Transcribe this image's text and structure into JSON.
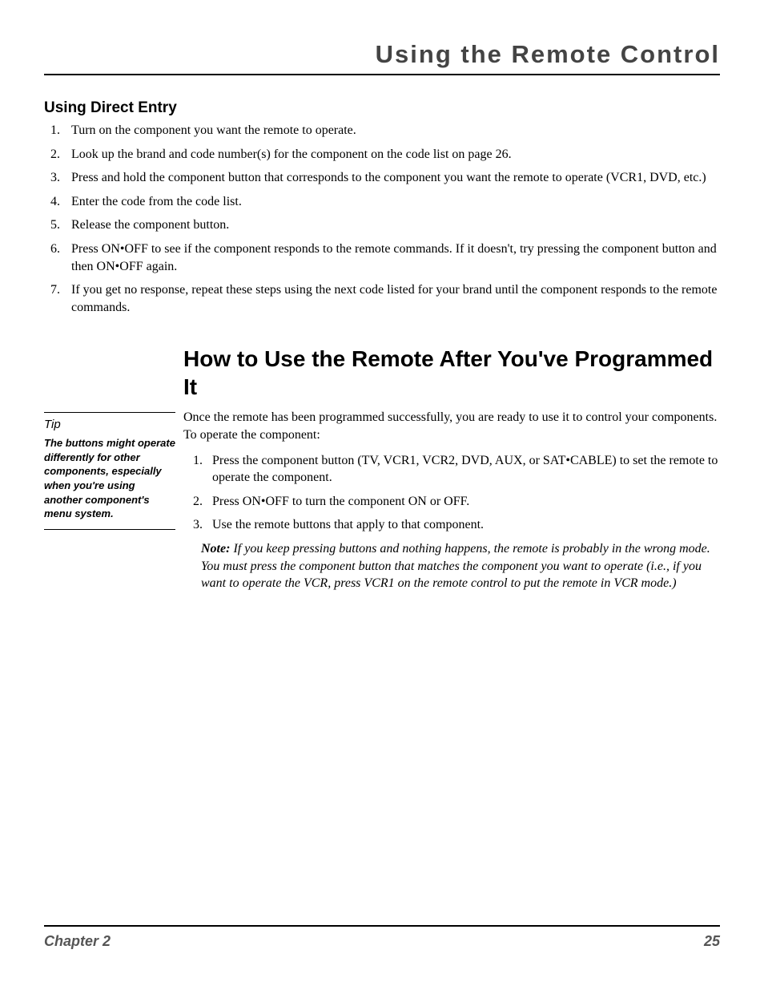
{
  "header_title": "Using the Remote Control",
  "section1_title": "Using Direct Entry",
  "section1_items": [
    "Turn on the component you want the remote to operate.",
    "Look up the brand and code number(s) for the component on the code list on page 26.",
    "Press and hold the component button that corresponds to the component you want the remote to operate (VCR1, DVD, etc.)",
    "Enter the code from the code list.",
    "Release the component button.",
    "Press ON•OFF to see if the component responds to the remote commands. If it doesn't, try pressing the component button and then ON•OFF again.",
    "If you get no response, repeat these steps using the next code listed for your brand until the component responds to the remote commands."
  ],
  "tip": {
    "title": "Tip",
    "body": "The buttons might operate differently for other components, especially when you're using another component's menu system."
  },
  "section2_title": "How to Use the Remote After You've Programmed It",
  "section2_intro": "Once the remote has been programmed successfully, you are ready to use it to control your components. To operate the component:",
  "section2_items": [
    "Press the component button (TV, VCR1, VCR2, DVD, AUX, or SAT•CABLE) to set the remote to operate the component.",
    "Press ON•OFF to turn the component ON or OFF.",
    "Use the remote buttons that apply to that component."
  ],
  "note_lead": "Note:",
  "note_body": " If you keep pressing buttons and nothing happens, the remote is probably in the wrong mode. You must press the component button that matches the component you want to operate (i.e., if you want to operate the VCR, press VCR1 on the remote control to put the remote in VCR mode.)",
  "footer_left": "Chapter 2",
  "footer_right": "25"
}
